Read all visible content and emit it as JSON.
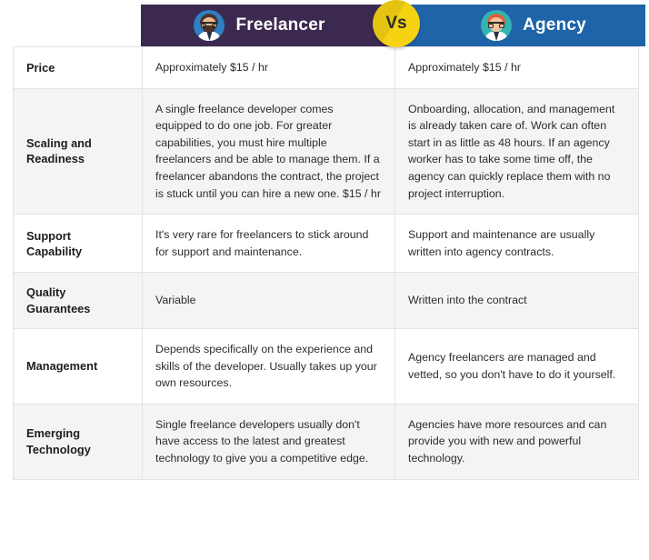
{
  "header": {
    "freelancer": {
      "label": "Freelancer",
      "avatar_icon": "freelancer-avatar-icon",
      "color": "#3b2950"
    },
    "agency": {
      "label": "Agency",
      "avatar_icon": "agency-avatar-icon",
      "color": "#1f63a8"
    },
    "vs_badge": {
      "label": "Vs",
      "color": "#f5d312"
    }
  },
  "table": {
    "rows": [
      {
        "feature": "Price",
        "freelancer": "Approximately $15 / hr",
        "agency": "Approximately $15 / hr",
        "stripe": "stripe-light"
      },
      {
        "feature": "Scaling and Readiness",
        "freelancer": "A single freelance developer comes equipped to do one job. For greater capabilities, you must hire multiple freelancers and be able to manage them. If a freelancer abandons the contract, the project is stuck until you can hire a new one. $15 / hr",
        "agency": "Onboarding, allocation, and management is already taken care of. Work can often start in as little as 48 hours. If an agency worker has to take some time off, the agency can quickly replace them with no project interruption.",
        "stripe": "stripe-gray"
      },
      {
        "feature": "Support Capability",
        "freelancer": "It's very rare for freelancers to stick around for support and maintenance.",
        "agency": "Support and maintenance are usually written into agency contracts.",
        "stripe": "stripe-light"
      },
      {
        "feature": "Quality Guarantees",
        "freelancer": "Variable",
        "agency": "Written into the contract",
        "stripe": "stripe-gray"
      },
      {
        "feature": "Management",
        "freelancer": "Depends specifically on the experience and skills of the developer. Usually takes up your own resources.",
        "agency": "Agency freelancers are managed and vetted, so you don't have to do it yourself.",
        "stripe": "stripe-light"
      },
      {
        "feature": "Emerging Technology",
        "freelancer": "Single freelance developers usually don't have access to the latest and greatest technology to give you a competitive edge.",
        "agency": "Agencies have more resources and can provide you with new and powerful technology.",
        "stripe": "stripe-gray"
      }
    ]
  }
}
